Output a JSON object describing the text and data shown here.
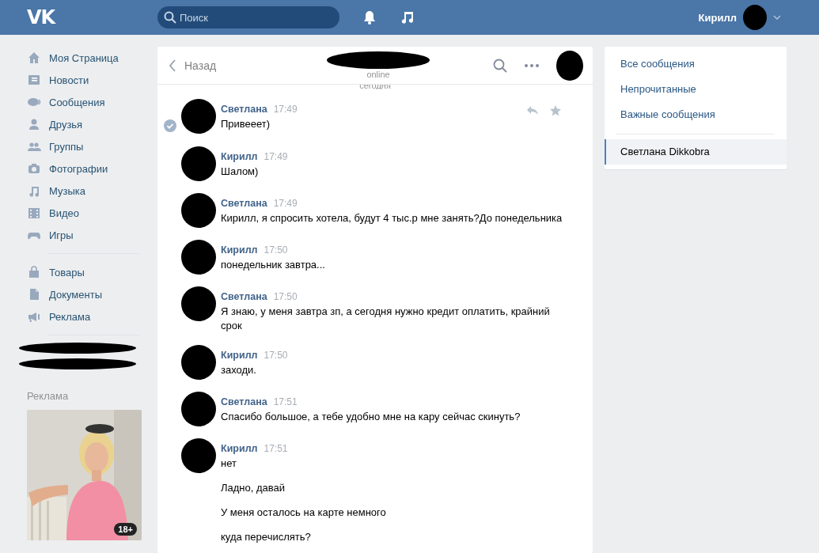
{
  "top_bar": {
    "logo": "VK",
    "search": {
      "placeholder": "Поиск"
    },
    "user": {
      "name": "Кирилл"
    }
  },
  "sidebar": {
    "groups": [
      [
        {
          "label": "Моя Страница",
          "kind": "home"
        },
        {
          "label": "Новости",
          "kind": "news"
        },
        {
          "label": "Сообщения",
          "kind": "messages"
        },
        {
          "label": "Друзья",
          "kind": "friends"
        },
        {
          "label": "Группы",
          "kind": "groups"
        },
        {
          "label": "Фотографии",
          "kind": "photos"
        },
        {
          "label": "Музыка",
          "kind": "music"
        },
        {
          "label": "Видео",
          "kind": "video"
        },
        {
          "label": "Игры",
          "kind": "games"
        }
      ],
      [
        {
          "label": "Товары",
          "kind": "goods"
        },
        {
          "label": "Документы",
          "kind": "docs"
        },
        {
          "label": "Реклама",
          "kind": "ads"
        }
      ]
    ],
    "ad": {
      "heading": "Реклама",
      "age_badge": "18+"
    }
  },
  "chat": {
    "back": "Назад",
    "status": "online",
    "date_divider": "сегодня",
    "messages": [
      {
        "author": "Светлана",
        "time": "17:49",
        "texts": [
          "Привееет)"
        ],
        "selected": true
      },
      {
        "author": "Кирилл",
        "time": "17:49",
        "texts": [
          "Шалом)"
        ],
        "selected": false
      },
      {
        "author": "Светлана",
        "time": "17:49",
        "texts": [
          "Кирилл, я спросить хотела, будут 4 тыс.р мне занять?До понедельника"
        ],
        "selected": false
      },
      {
        "author": "Кирилл",
        "time": "17:50",
        "texts": [
          "понедельник завтра..."
        ],
        "selected": false
      },
      {
        "author": "Светлана",
        "time": "17:50",
        "texts": [
          "Я знаю, у меня завтра зп, а сегодня нужно кредит оплатить, крайний срок"
        ],
        "selected": false
      },
      {
        "author": "Кирилл",
        "time": "17:50",
        "texts": [
          "заходи."
        ],
        "selected": false
      },
      {
        "author": "Светлана",
        "time": "17:51",
        "texts": [
          "Спасибо большое, а тебе удобно мне на кару сейчас скинуть?"
        ],
        "selected": false
      },
      {
        "author": "Кирилл",
        "time": "17:51",
        "texts": [
          "нет",
          "Ладно, давай",
          "У меня осталось на карте немного",
          "куда перечислять?"
        ],
        "selected": false
      }
    ]
  },
  "filters": {
    "items": [
      {
        "label": "Все сообщения",
        "selected": false
      },
      {
        "label": "Непрочитанные",
        "selected": false
      },
      {
        "label": "Важные сообщения",
        "selected": false
      }
    ],
    "conversations": [
      {
        "label": "Светлана Dikkobra",
        "selected": true
      }
    ]
  }
}
